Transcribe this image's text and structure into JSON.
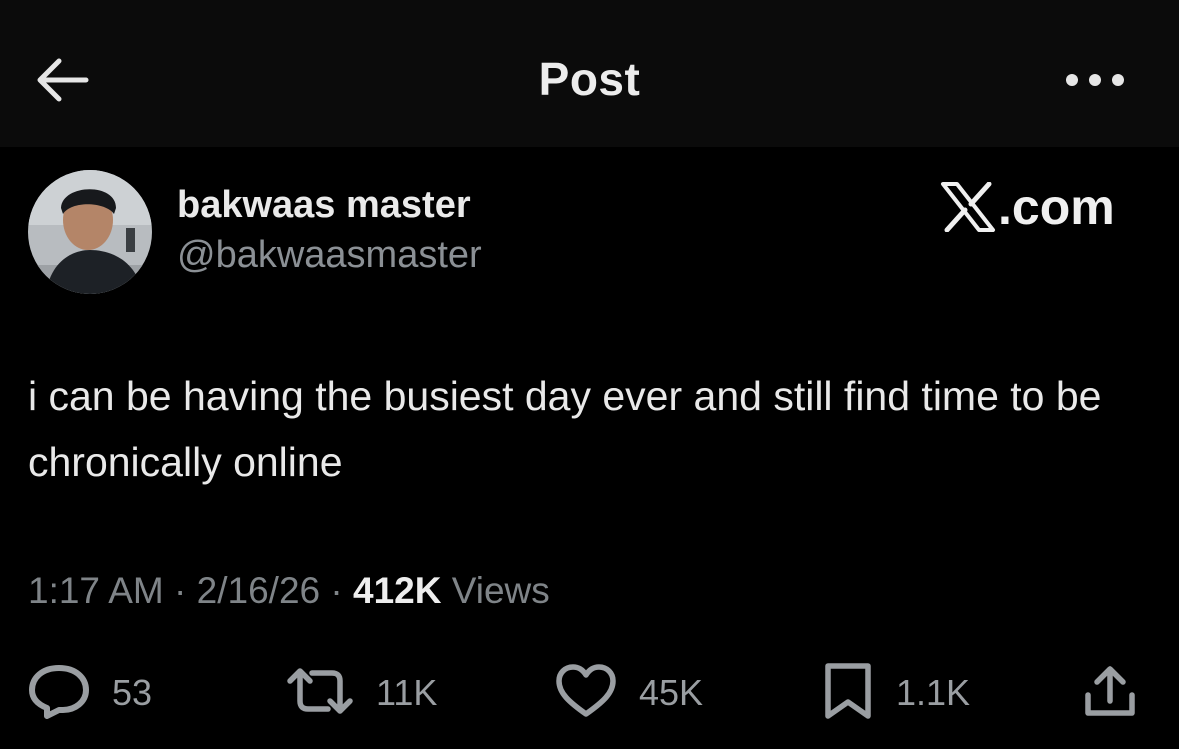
{
  "header": {
    "title": "Post",
    "back_icon": "arrow-left-icon",
    "more_icon": "more-horizontal-icon"
  },
  "author": {
    "display_name": "bakwaas master",
    "handle": "@bakwaasmaster"
  },
  "brand": {
    "logo_icon": "x-logo-icon",
    "text": ".com"
  },
  "post": {
    "text": "i can be having the busiest day ever and still find time to be chronically online"
  },
  "meta": {
    "time": "1:17 AM",
    "sep1": " · ",
    "date": "2/16/26",
    "sep2": " · ",
    "views_count": "412K",
    "views_label": " Views"
  },
  "actions": {
    "reply": {
      "icon": "reply-icon",
      "count": "53"
    },
    "repost": {
      "icon": "repost-icon",
      "count": "11K"
    },
    "like": {
      "icon": "heart-icon",
      "count": "45K"
    },
    "bookmark": {
      "icon": "bookmark-icon",
      "count": "1.1K"
    },
    "share": {
      "icon": "share-icon"
    }
  },
  "colors": {
    "background": "#000000",
    "header_background": "#0b0b0b",
    "text_primary": "#e7e9ea",
    "text_secondary": "#8b9095",
    "icon_gray": "#9a9ea2"
  }
}
